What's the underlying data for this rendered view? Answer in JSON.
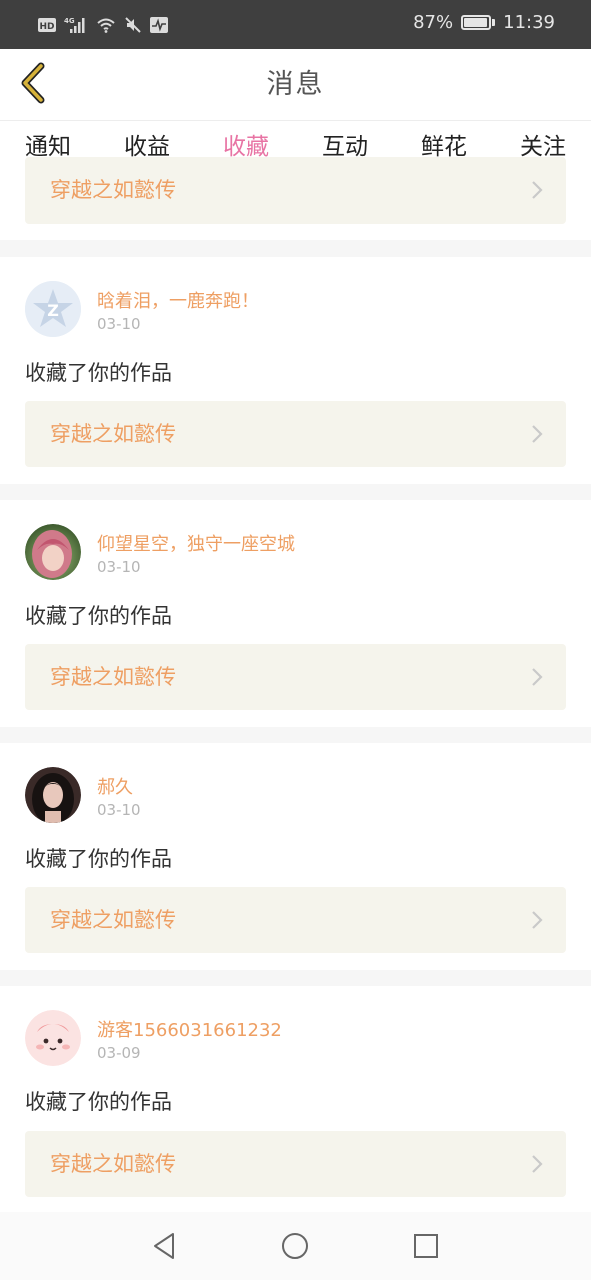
{
  "status_bar": {
    "hd_label": "HD",
    "network_label": "4G",
    "battery_percent_text": "87%",
    "battery_level": 0.87,
    "time": "11:39",
    "icons": [
      "hd-icon",
      "signal-4g-icon",
      "wifi-icon",
      "mute-icon",
      "activity-icon",
      "battery-icon"
    ]
  },
  "header": {
    "title": "消息",
    "back_icon": "chevron-left-icon",
    "back_color": "#d6b23a"
  },
  "tabs": [
    {
      "label": "通知",
      "active": false
    },
    {
      "label": "收益",
      "active": false
    },
    {
      "label": "收藏",
      "active": true
    },
    {
      "label": "互动",
      "active": false
    },
    {
      "label": "鲜花",
      "active": false
    },
    {
      "label": "关注",
      "active": false
    }
  ],
  "partial_card": {
    "work_title": "穿越之如懿传"
  },
  "notifications": [
    {
      "username": "晗着泪，一鹿奔跑！",
      "date": "03-10",
      "action": "收藏了你的作品",
      "work_title": "穿越之如懿传",
      "avatar": "qq-logo-avatar"
    },
    {
      "username": "仰望星空，独守一座空城",
      "date": "03-10",
      "action": "收藏了你的作品",
      "work_title": "穿越之如懿传",
      "avatar": "pink-hair-girl-avatar"
    },
    {
      "username": "郝久",
      "date": "03-10",
      "action": "收藏了你的作品",
      "work_title": "穿越之如懿传",
      "avatar": "dark-hair-girl-avatar"
    },
    {
      "username": "游客1566031661232",
      "date": "03-09",
      "action": "收藏了你的作品",
      "work_title": "穿越之如懿传",
      "avatar": "pink-blob-avatar"
    }
  ],
  "colors": {
    "accent_pink": "#e874a4",
    "username_orange": "#ee9f63",
    "link_background": "#f5f4ec"
  },
  "nav_bar": {
    "icons": [
      "back-triangle-icon",
      "home-circle-icon",
      "recents-square-icon"
    ]
  }
}
